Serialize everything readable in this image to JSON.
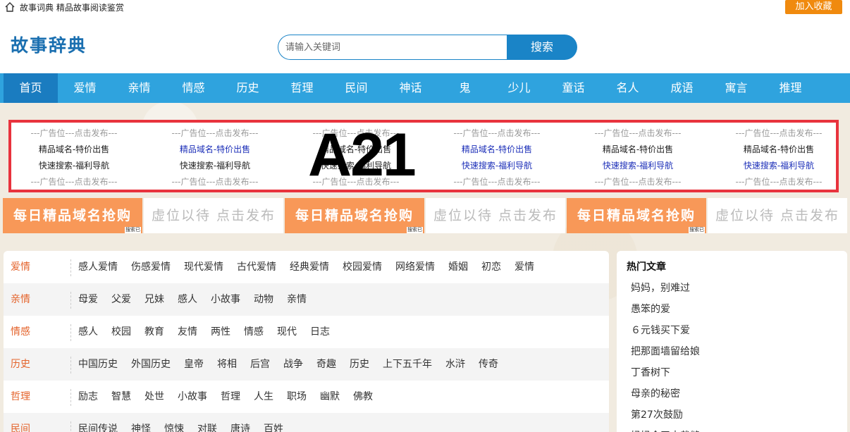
{
  "topbar": {
    "tagline": "故事词典 精品故事阅读鉴赏",
    "favorite": "加入收藏"
  },
  "header": {
    "logo": "故事辞典",
    "search_placeholder": "请输入关键词",
    "search_button": "搜索"
  },
  "nav": [
    "首页",
    "爱情",
    "亲情",
    "情感",
    "历史",
    "哲理",
    "民间",
    "神话",
    "鬼",
    "少儿",
    "童话",
    "名人",
    "成语",
    "寓言",
    "推理"
  ],
  "ads": {
    "columns": [
      {
        "slot": "---广告位---点击发布---",
        "l1": "精品域名-特价出售",
        "l2": "快速搜索-福利导航",
        "style": "dark"
      },
      {
        "slot": "---广告位---点击发布---",
        "l1": "精品域名-特价出售",
        "l2": "快速搜索-福利导航",
        "style": "mixed"
      },
      {
        "slot": "---广告位---点击发布---",
        "l1": "精品域名-特价出售",
        "l2": "快速搜索-福利导航",
        "style": "dark"
      },
      {
        "slot": "---广告位---点击发布---",
        "l1": "精品域名-特价出售",
        "l2": "快速搜索-福利导航",
        "style": "blue"
      },
      {
        "slot": "---广告位---点击发布---",
        "l1": "精品域名-特价出售",
        "l2": "快速搜索-福利导航",
        "style": "mixed"
      },
      {
        "slot": "---广告位---点击发布---",
        "l1": "精品域名-特价出售",
        "l2": "快速搜索-福利导航",
        "style": "mixed"
      }
    ],
    "marker": "A21"
  },
  "banners": [
    {
      "text": "每日精品域名抢购",
      "type": "orange",
      "mini": "搜索已"
    },
    {
      "text": "虚位以待 点击发布",
      "type": "white"
    },
    {
      "text": "每日精品域名抢购",
      "type": "orange",
      "mini": "搜索已"
    },
    {
      "text": "虚位以待 点击发布",
      "type": "white"
    },
    {
      "text": "每日精品域名抢购",
      "type": "orange",
      "mini": "搜索已"
    },
    {
      "text": "虚位以待 点击发布",
      "type": "white"
    }
  ],
  "categories": [
    {
      "name": "爱情",
      "tags": [
        "感人爱情",
        "伤感爱情",
        "现代爱情",
        "古代爱情",
        "经典爱情",
        "校园爱情",
        "网络爱情",
        "婚姻",
        "初恋",
        "爱情"
      ]
    },
    {
      "name": "亲情",
      "tags": [
        "母爱",
        "父爱",
        "兄妹",
        "感人",
        "小故事",
        "动物",
        "亲情"
      ]
    },
    {
      "name": "情感",
      "tags": [
        "感人",
        "校园",
        "教育",
        "友情",
        "两性",
        "情感",
        "现代",
        "日志"
      ]
    },
    {
      "name": "历史",
      "tags": [
        "中国历史",
        "外国历史",
        "皇帝",
        "将相",
        "后宫",
        "战争",
        "奇趣",
        "历史",
        "上下五千年",
        "水浒",
        "传奇"
      ]
    },
    {
      "name": "哲理",
      "tags": [
        "励志",
        "智慧",
        "处世",
        "小故事",
        "哲理",
        "人生",
        "职场",
        "幽默",
        "佛教"
      ]
    },
    {
      "name": "民间",
      "tags": [
        "民间传说",
        "神怪",
        "惊悚",
        "对联",
        "唐诗",
        "百姓"
      ]
    }
  ],
  "hot": {
    "title": "热门文章",
    "items": [
      "妈妈，别难过",
      "愚笨的爱",
      "６元钱买下爱",
      "把那面墙留给娘",
      "丁香树下",
      "母亲的秘密",
      "第27次鼓励",
      "妈妈今天去裁缝"
    ]
  }
}
